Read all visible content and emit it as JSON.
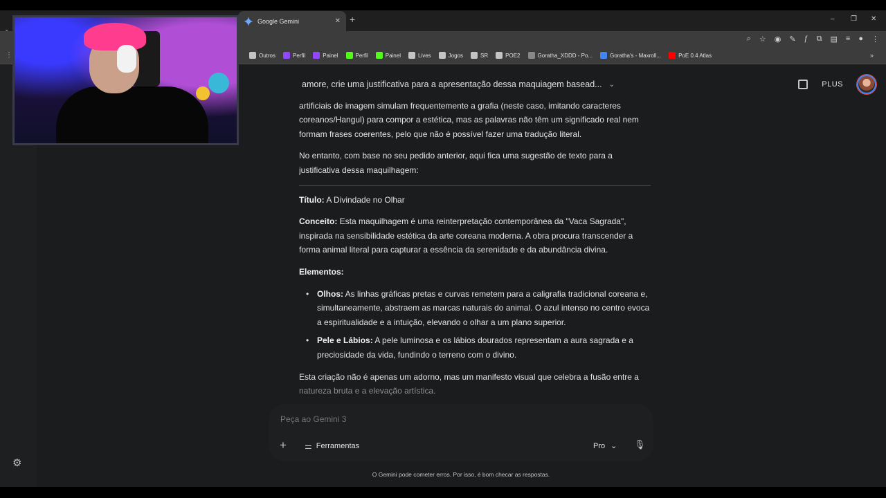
{
  "browser": {
    "active_tab_title": "Google Gemini",
    "bookmarks": [
      {
        "label": "Outros",
        "color": "#c4c4c4"
      },
      {
        "label": "Perfil",
        "color": "#9146ff"
      },
      {
        "label": "Painel",
        "color": "#9146ff"
      },
      {
        "label": "Perfil",
        "color": "#53fc18"
      },
      {
        "label": "Painel",
        "color": "#53fc18"
      },
      {
        "label": "Lives",
        "color": "#c4c4c4"
      },
      {
        "label": "Jogos",
        "color": "#c4c4c4"
      },
      {
        "label": "SR",
        "color": "#c4c4c4"
      },
      {
        "label": "POE2",
        "color": "#c4c4c4"
      },
      {
        "label": "Goratha_XDDD - Po...",
        "color": "#888888"
      },
      {
        "label": "Goratha's - Maxroll...",
        "color": "#4285f4"
      },
      {
        "label": "PoE 0.4 Atlas",
        "color": "#ff0000"
      }
    ]
  },
  "header": {
    "chat_title": "amore, crie uma justificativa para a apresentação dessa maquiagem basead...",
    "plus_label": "PLUS"
  },
  "response": {
    "partial_top": "O texto que aparece na imagem gerada é puramente ilustrativo e decorativo. As inteligências artificiais de imagem simulam frequentemente a grafia (neste caso, imitando caracteres coreanos/Hangul) para compor a estética, mas as palavras não têm um significado real nem formam frases coerentes, pelo que não é possível fazer uma tradução literal.",
    "intro": "No entanto, com base no seu pedido anterior, aqui fica uma sugestão de texto para a justificativa dessa maquilhagem:",
    "title_label": "Título:",
    "title_value": " A Divindade no Olhar",
    "concept_label": "Conceito:",
    "concept_value": " Esta maquilhagem é uma reinterpretação contemporânea da \"Vaca Sagrada\", inspirada na sensibilidade estética da arte coreana moderna. A obra procura transcender a forma animal literal para capturar a essência da serenidade e da abundância divina.",
    "elements_heading": "Elementos:",
    "items": [
      {
        "label": "Olhos:",
        "text": " As linhas gráficas pretas e curvas remetem para a caligrafia tradicional coreana e, simultaneamente, abstraem as marcas naturais do animal. O azul intenso no centro evoca a espiritualidade e a intuição, elevando o olhar a um plano superior."
      },
      {
        "label": "Pele e Lábios:",
        "text": " A pele luminosa e os lábios dourados representam a aura sagrada e a preciosidade da vida, fundindo o terreno com o divino."
      }
    ],
    "closing_a": "Esta criação não é apenas um adorno, mas um manifesto visual que celebra a fusão entre a ",
    "closing_b": "natureza bruta e a elevação artística."
  },
  "composer": {
    "placeholder": "Peça ao Gemini 3",
    "tools_label": "Ferramentas",
    "model_label": "Pro"
  },
  "footer": {
    "disclaimer": "O Gemini pode cometer erros. Por isso, é bom checar as respostas."
  }
}
